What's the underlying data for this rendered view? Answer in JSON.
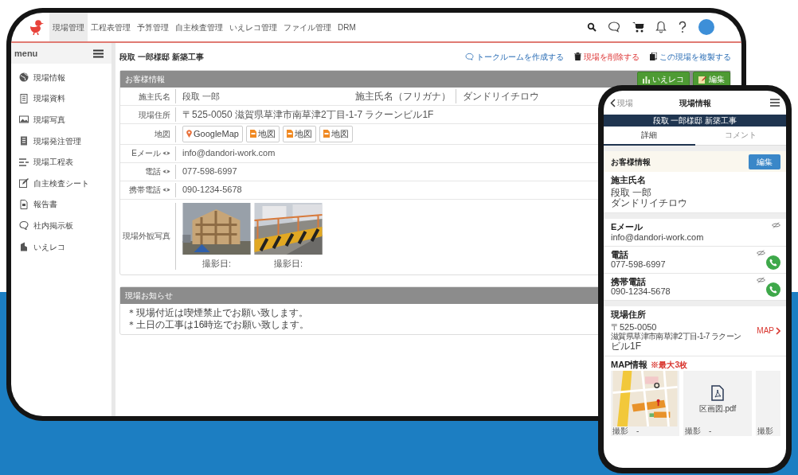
{
  "tablet": {
    "nav_items": [
      {
        "label": "現場管理",
        "selected": true
      },
      {
        "label": "工程表管理",
        "selected": false
      },
      {
        "label": "予算管理",
        "selected": false
      },
      {
        "label": "自主検査管理",
        "selected": false
      },
      {
        "label": "いえレコ管理",
        "selected": false
      },
      {
        "label": "ファイル管理",
        "selected": false
      },
      {
        "label": "DRM",
        "selected": false
      }
    ],
    "sidebar": {
      "title": "menu",
      "items": [
        {
          "label": "現場情報"
        },
        {
          "label": "現場資料"
        },
        {
          "label": "現場写真"
        },
        {
          "label": "現場発注管理"
        },
        {
          "label": "現場工程表"
        },
        {
          "label": "自主検査シート"
        },
        {
          "label": "報告書"
        },
        {
          "label": "社内掲示板"
        },
        {
          "label": "いえレコ"
        }
      ]
    },
    "page_title": "段取 一郎様邸 新築工事",
    "actions": [
      {
        "label": "トークルームを作成する",
        "kind": "chat"
      },
      {
        "label": "現場を削除する",
        "kind": "delete"
      },
      {
        "label": "この現場を複製する",
        "kind": "copy"
      }
    ],
    "customer_card": {
      "title": "お客様情報",
      "buttons": [
        {
          "label": "いえレコ",
          "kind": "house"
        },
        {
          "label": "編集",
          "kind": "edit"
        }
      ],
      "rows": [
        {
          "kind": "pair",
          "label": "施主氏名",
          "value": "段取 一郎",
          "label_2": "施主氏名（フリガナ）",
          "value_2": "ダンドリイチロウ"
        },
        {
          "kind": "text",
          "label": "現場住所",
          "value": "〒525-0050 滋賀県草津市南草津2丁目-1-7 ラクーンビル1F"
        },
        {
          "kind": "maps",
          "label": "地図",
          "buttons": [
            {
              "label": "GoogleMap",
              "kind": "pin"
            },
            {
              "label": "地図",
              "kind": "file"
            },
            {
              "label": "地図",
              "kind": "file"
            },
            {
              "label": "地図",
              "kind": "file"
            }
          ]
        },
        {
          "kind": "private",
          "label": "Eメール",
          "value": "info@dandori-work.com"
        },
        {
          "kind": "private",
          "label": "電話",
          "value": "077-598-6997"
        },
        {
          "kind": "private",
          "label": "携帯電話",
          "value": "090-1234-5678"
        },
        {
          "kind": "photos",
          "label": "現場外観写真",
          "photos": [
            {
              "kind": "picture",
              "caption": "撮影日:"
            },
            {
              "kind": "picture",
              "caption": "撮影日:"
            }
          ]
        }
      ]
    },
    "notice_card": {
      "title": "現場お知らせ",
      "lines": [
        "＊現場付近は喫煙禁止でお願い致します。",
        "＊土日の工事は16時迄でお願い致します。"
      ]
    }
  },
  "phone": {
    "header": {
      "back": "現場",
      "title": "現場情報"
    },
    "banner": "段取 一郎様邸 新築工事",
    "tabs": [
      {
        "label": "詳細",
        "selected": true
      },
      {
        "label": "コメント",
        "selected": false
      }
    ],
    "section": {
      "title": "お客様情報",
      "button": "編集"
    },
    "owner": {
      "label": "施主氏名",
      "lines": [
        "段取 一郎",
        "ダンドリイチロウ"
      ]
    },
    "contacts": [
      {
        "label": "Eメール",
        "value": "info@dandori-work.com",
        "callable": false
      },
      {
        "label": "電話",
        "value": "077-598-6997",
        "callable": true
      },
      {
        "label": "携帯電話",
        "value": "090-1234-5678",
        "callable": true
      }
    ],
    "address": {
      "label": "現場住所",
      "lines": [
        "〒525-0050",
        "滋賀県草津市南草津2丁目-1-7 ラクーン",
        "ビル1F"
      ],
      "link": "MAP"
    },
    "map_info": {
      "title": "MAP情報",
      "note": "※最大3枚",
      "tiles": [
        {
          "kind": "picture",
          "caption": "撮影",
          "value": "-"
        },
        {
          "kind": "file",
          "file": "区画図.pdf",
          "caption": "撮影",
          "value": "-"
        },
        {
          "kind": "file",
          "caption": "撮影"
        }
      ]
    }
  }
}
